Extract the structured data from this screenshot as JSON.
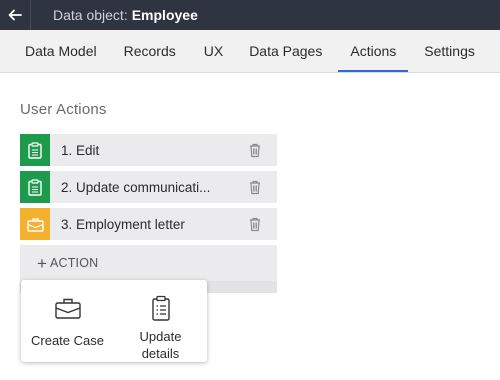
{
  "topbar": {
    "title_prefix": "Data object:",
    "title_name": "Employee"
  },
  "tabs": [
    {
      "label": "Data Model"
    },
    {
      "label": "Records"
    },
    {
      "label": "UX"
    },
    {
      "label": "Data Pages"
    },
    {
      "label": "Actions",
      "active": true
    },
    {
      "label": "Settings"
    }
  ],
  "section": {
    "title": "User Actions"
  },
  "actions": [
    {
      "number": "1.",
      "label": "Edit",
      "icon": "clipboard-icon",
      "color": "#1d9a4c"
    },
    {
      "number": "2.",
      "label": "Update communicati...",
      "icon": "clipboard-icon",
      "color": "#1d9a4c"
    },
    {
      "number": "3.",
      "label": "Employment letter",
      "icon": "briefcase-icon",
      "color": "#f4b130"
    }
  ],
  "add_action": {
    "plus": "+",
    "label": "ACTION"
  },
  "popover": {
    "options": [
      {
        "label": "Create Case",
        "icon": "briefcase-icon"
      },
      {
        "label_line1": "Update",
        "label_line2": "details",
        "icon": "list-clipboard-icon"
      }
    ]
  },
  "colors": {
    "topbar": "#2e3440",
    "accent": "#2e6bd6",
    "green": "#1d9a4c",
    "orange": "#f4b130"
  }
}
